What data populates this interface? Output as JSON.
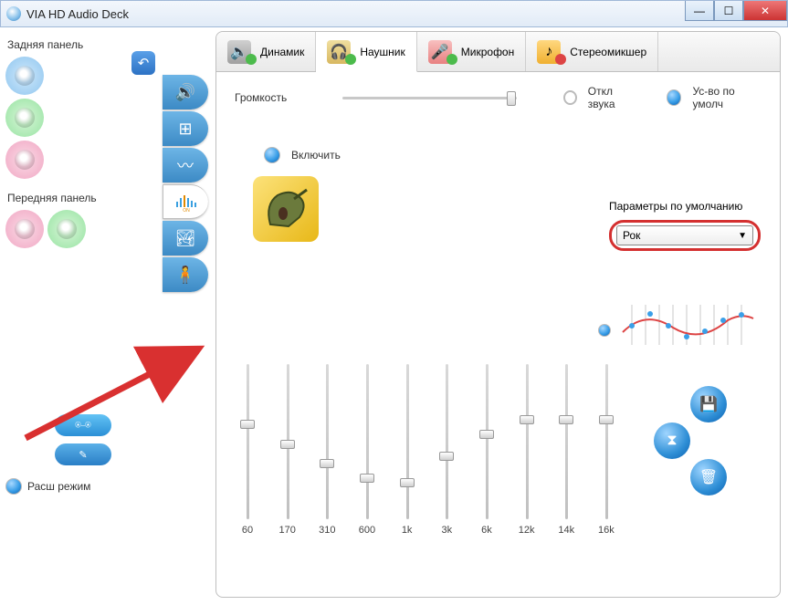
{
  "window": {
    "title": "VIA HD Audio Deck"
  },
  "left": {
    "rear_label": "Задняя панель",
    "front_label": "Передняя панель",
    "mode_label": "Расш режим"
  },
  "tabs": {
    "speaker": "Динамик",
    "headphone": "Наушник",
    "mic": "Микрофон",
    "mixer": "Стереомикшер"
  },
  "volume": {
    "label": "Громкость",
    "mute": "Откл звука",
    "default_device": "Ус-во по умолч"
  },
  "eq_section": {
    "enable": "Включить",
    "preset_header": "Параметры по умолчанию",
    "preset_value": "Рок"
  },
  "eq": {
    "bands": [
      {
        "freq": "60",
        "pos": 38
      },
      {
        "freq": "170",
        "pos": 52
      },
      {
        "freq": "310",
        "pos": 65
      },
      {
        "freq": "600",
        "pos": 75
      },
      {
        "freq": "1k",
        "pos": 78
      },
      {
        "freq": "3k",
        "pos": 60
      },
      {
        "freq": "6k",
        "pos": 45
      },
      {
        "freq": "12k",
        "pos": 35
      },
      {
        "freq": "14k",
        "pos": 35
      },
      {
        "freq": "16k",
        "pos": 35
      }
    ]
  }
}
